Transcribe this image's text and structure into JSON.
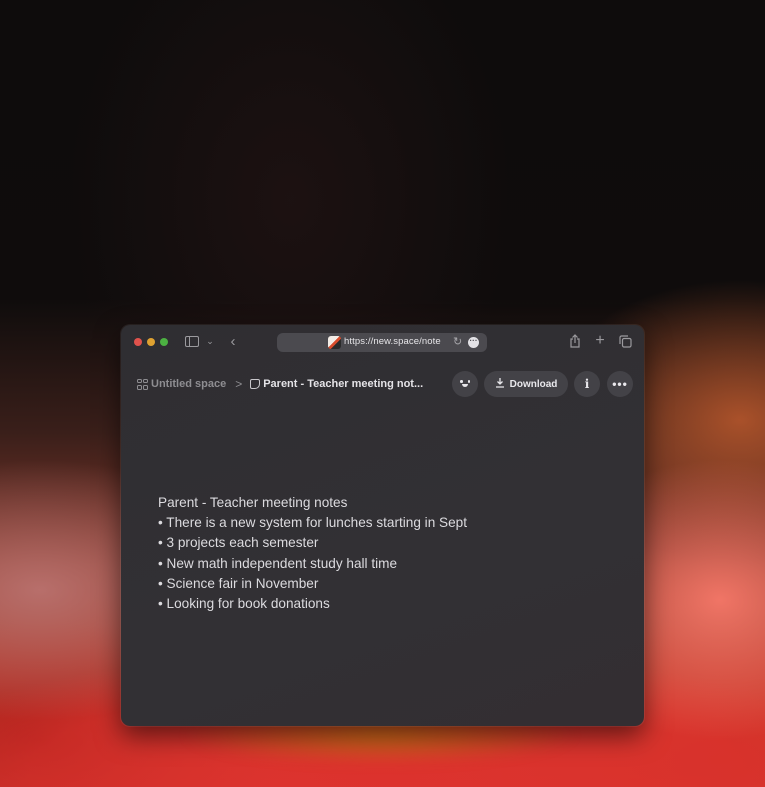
{
  "browser": {
    "url": "https://new.space/note",
    "traffic_lights": {
      "close": "#e0524c",
      "minimize": "#dea131",
      "zoom": "#4cb142"
    },
    "icons": {
      "sidebar": "sidebar-icon",
      "chevron": "chevron-down-icon",
      "back": "back-icon",
      "reload": "reload-icon",
      "page_menu": "more-icon",
      "share": "share-icon",
      "new_tab": "plus-icon",
      "tabs": "tab-overview-icon"
    }
  },
  "header": {
    "breadcrumb": {
      "space_label": "Untitled space",
      "separator": ">",
      "note_label": "Parent - Teacher meeting not..."
    },
    "download_label": "Download",
    "info_label": "i",
    "more_label": "•••"
  },
  "note": {
    "title": "Parent - Teacher meeting notes",
    "bullets": [
      "• There is a new system for lunches starting in Sept",
      "• 3 projects each semester",
      "• New math independent study hall time",
      "• Science fair in November",
      "• Looking for book donations"
    ]
  }
}
